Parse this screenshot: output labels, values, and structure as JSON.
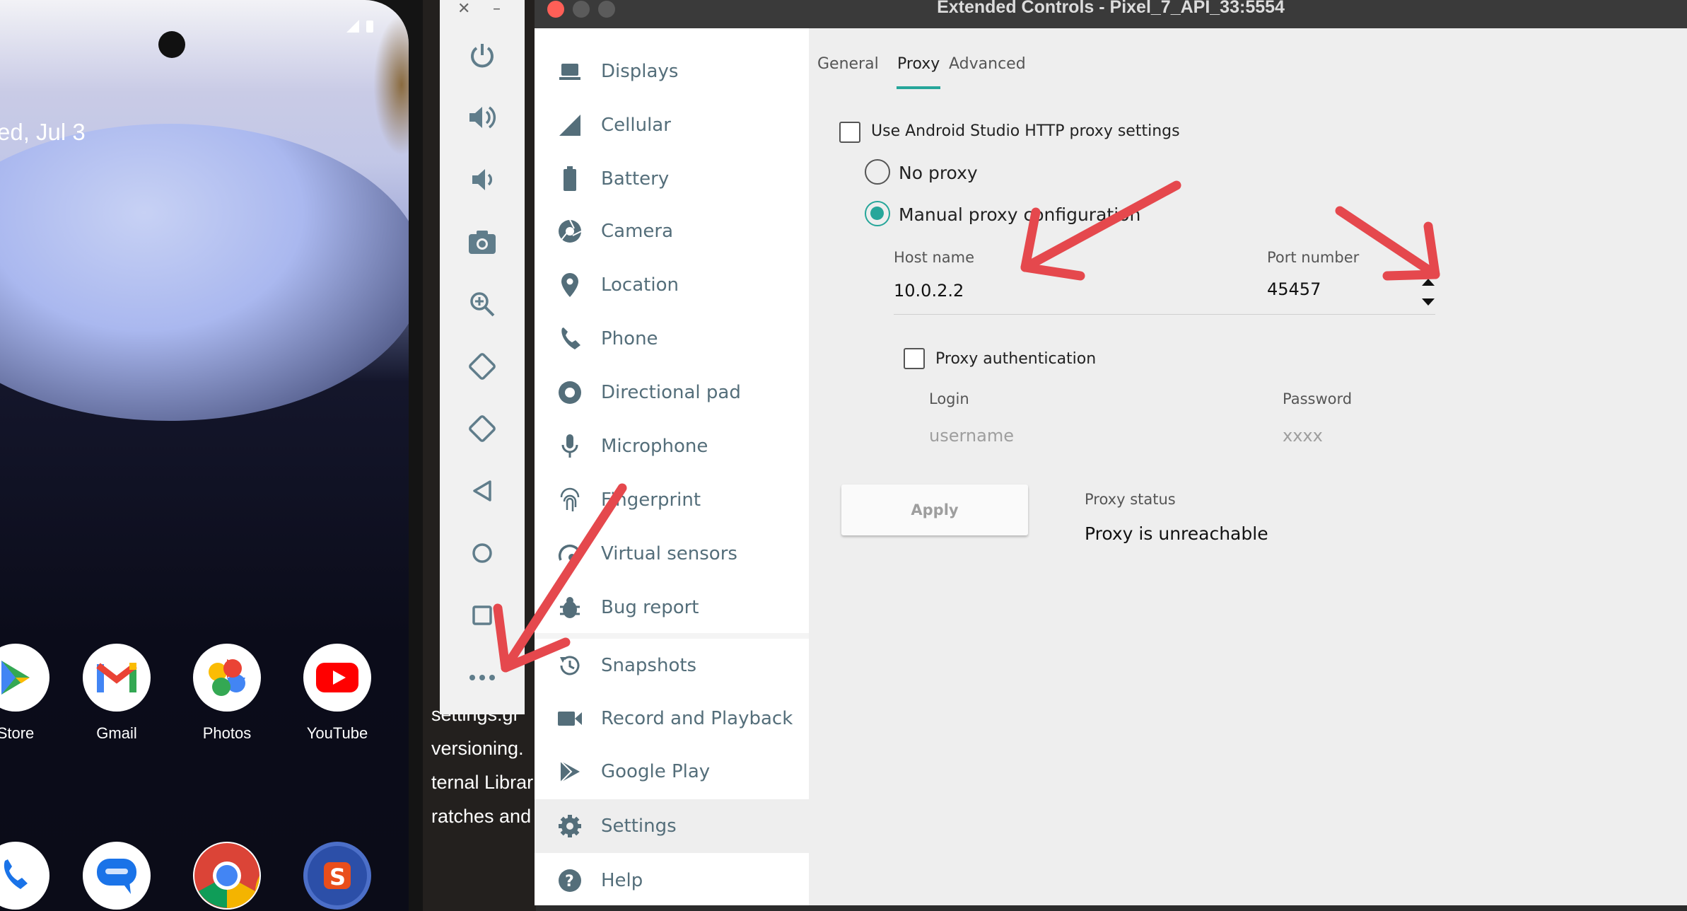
{
  "phone": {
    "date": "ed, Jul 3",
    "apps_row1": [
      {
        "label": "Store",
        "icon": "play-store-icon"
      },
      {
        "label": "Gmail",
        "icon": "gmail-icon"
      },
      {
        "label": "Photos",
        "icon": "photos-icon"
      },
      {
        "label": "YouTube",
        "icon": "youtube-icon"
      }
    ],
    "apps_row2": [
      {
        "icon": "phone-app-icon"
      },
      {
        "icon": "messages-icon"
      },
      {
        "icon": "chrome-icon"
      },
      {
        "icon": "custom-app-icon"
      }
    ]
  },
  "terminal": {
    "lines": [
      "settings.gr",
      "versioning.",
      "ternal Librar",
      "ratches and"
    ]
  },
  "toolbar": {
    "buttons": [
      "power-icon",
      "volume-up-icon",
      "volume-down-icon",
      "camera-icon",
      "zoom-icon",
      "rotate-left-icon",
      "rotate-right-icon",
      "back-icon",
      "home-icon",
      "overview-icon",
      "more-icon"
    ]
  },
  "window": {
    "title": "Extended Controls - Pixel_7_API_33:5554"
  },
  "sidebar": {
    "items": [
      {
        "label": "Displays",
        "icon": "displays-icon"
      },
      {
        "label": "Cellular",
        "icon": "cellular-icon"
      },
      {
        "label": "Battery",
        "icon": "battery-icon"
      },
      {
        "label": "Camera",
        "icon": "camera-icon"
      },
      {
        "label": "Location",
        "icon": "location-icon"
      },
      {
        "label": "Phone",
        "icon": "phone-icon"
      },
      {
        "label": "Directional pad",
        "icon": "dpad-icon"
      },
      {
        "label": "Microphone",
        "icon": "microphone-icon"
      },
      {
        "label": "Fingerprint",
        "icon": "fingerprint-icon"
      },
      {
        "label": "Virtual sensors",
        "icon": "virtual-sensors-icon"
      },
      {
        "label": "Bug report",
        "icon": "bug-icon"
      },
      {
        "label": "Snapshots",
        "icon": "snapshots-icon"
      },
      {
        "label": "Record and Playback",
        "icon": "record-icon"
      },
      {
        "label": "Google Play",
        "icon": "google-play-icon"
      },
      {
        "label": "Settings",
        "icon": "settings-icon"
      },
      {
        "label": "Help",
        "icon": "help-icon"
      }
    ],
    "active": "Settings"
  },
  "tabs": {
    "general": "General",
    "proxy": "Proxy",
    "advanced": "Advanced",
    "active": "Proxy"
  },
  "proxy": {
    "use_studio_label": "Use Android Studio HTTP proxy settings",
    "use_studio_checked": false,
    "no_proxy_label": "No proxy",
    "manual_label": "Manual proxy configuration",
    "selected": "Manual proxy configuration",
    "host_label": "Host name",
    "host_value": "10.0.2.2",
    "port_label": "Port number",
    "port_value": "45457",
    "auth_label": "Proxy authentication",
    "auth_checked": false,
    "login_label": "Login",
    "login_placeholder": "username",
    "password_label": "Password",
    "password_placeholder": "xxxx",
    "apply_label": "Apply",
    "status_label": "Proxy status",
    "status_value": "Proxy is unreachable"
  },
  "colors": {
    "accent": "#26a69a",
    "nav_text": "#546e7a",
    "annotation_arrow": "#e5484d"
  }
}
